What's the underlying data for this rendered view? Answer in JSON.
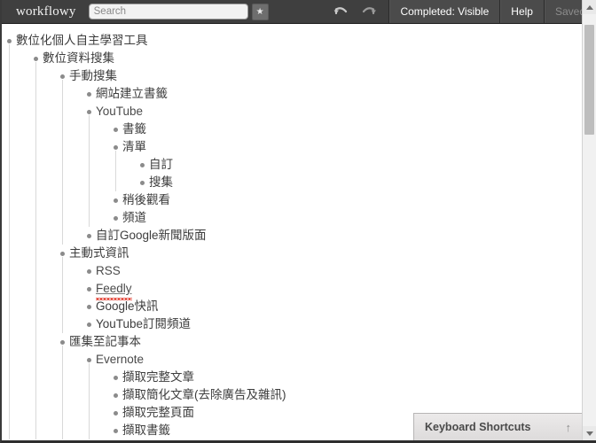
{
  "header": {
    "logo": "workflowy",
    "search": {
      "value": "",
      "placeholder": "Search"
    },
    "star_label": "★",
    "undo_icon": "undo-icon",
    "redo_icon": "redo-icon",
    "completed_label": "Completed: Visible",
    "help_label": "Help",
    "saved_label": "Saved"
  },
  "scrollbar": {
    "up_icon": "scroll-up-arrow-icon",
    "down_icon": "scroll-down-arrow-icon"
  },
  "footer": {
    "keyboard_shortcuts_label": "Keyboard Shortcuts",
    "keyboard_shortcuts_arrow": "↑"
  },
  "outline": [
    {
      "label": "數位化個人自主學習工具",
      "cjk": true,
      "children": [
        {
          "label": "數位資料搜集",
          "cjk": true,
          "children": [
            {
              "label": "手動搜集",
              "cjk": true,
              "children": [
                {
                  "label": "網站建立書籤",
                  "cjk": true
                },
                {
                  "label": "YouTube",
                  "cjk": false,
                  "children": [
                    {
                      "label": "書籤",
                      "cjk": true
                    },
                    {
                      "label": "清單",
                      "cjk": true,
                      "children": [
                        {
                          "label": "自訂",
                          "cjk": true
                        },
                        {
                          "label": "搜集",
                          "cjk": true
                        }
                      ]
                    },
                    {
                      "label": "稍後觀看",
                      "cjk": true
                    },
                    {
                      "label": "頻道",
                      "cjk": true
                    }
                  ]
                },
                {
                  "label": "自訂Google新聞版面",
                  "cjk": true
                }
              ]
            },
            {
              "label": "主動式資訊",
              "cjk": true,
              "children": [
                {
                  "label": "RSS",
                  "cjk": false
                },
                {
                  "label": "Feedly",
                  "cjk": false,
                  "link": true
                },
                {
                  "label": "Google快訊",
                  "cjk": true
                },
                {
                  "label": "YouTube訂閱頻道",
                  "cjk": true
                }
              ]
            },
            {
              "label": "匯集至記事本",
              "cjk": true,
              "children": [
                {
                  "label": "Evernote",
                  "cjk": false,
                  "children": [
                    {
                      "label": "擷取完整文章",
                      "cjk": true
                    },
                    {
                      "label": "擷取簡化文章(去除廣告及雜訊)",
                      "cjk": true
                    },
                    {
                      "label": "擷取完整頁面",
                      "cjk": true
                    },
                    {
                      "label": "擷取書籤",
                      "cjk": true
                    }
                  ]
                }
              ]
            }
          ]
        }
      ]
    }
  ]
}
